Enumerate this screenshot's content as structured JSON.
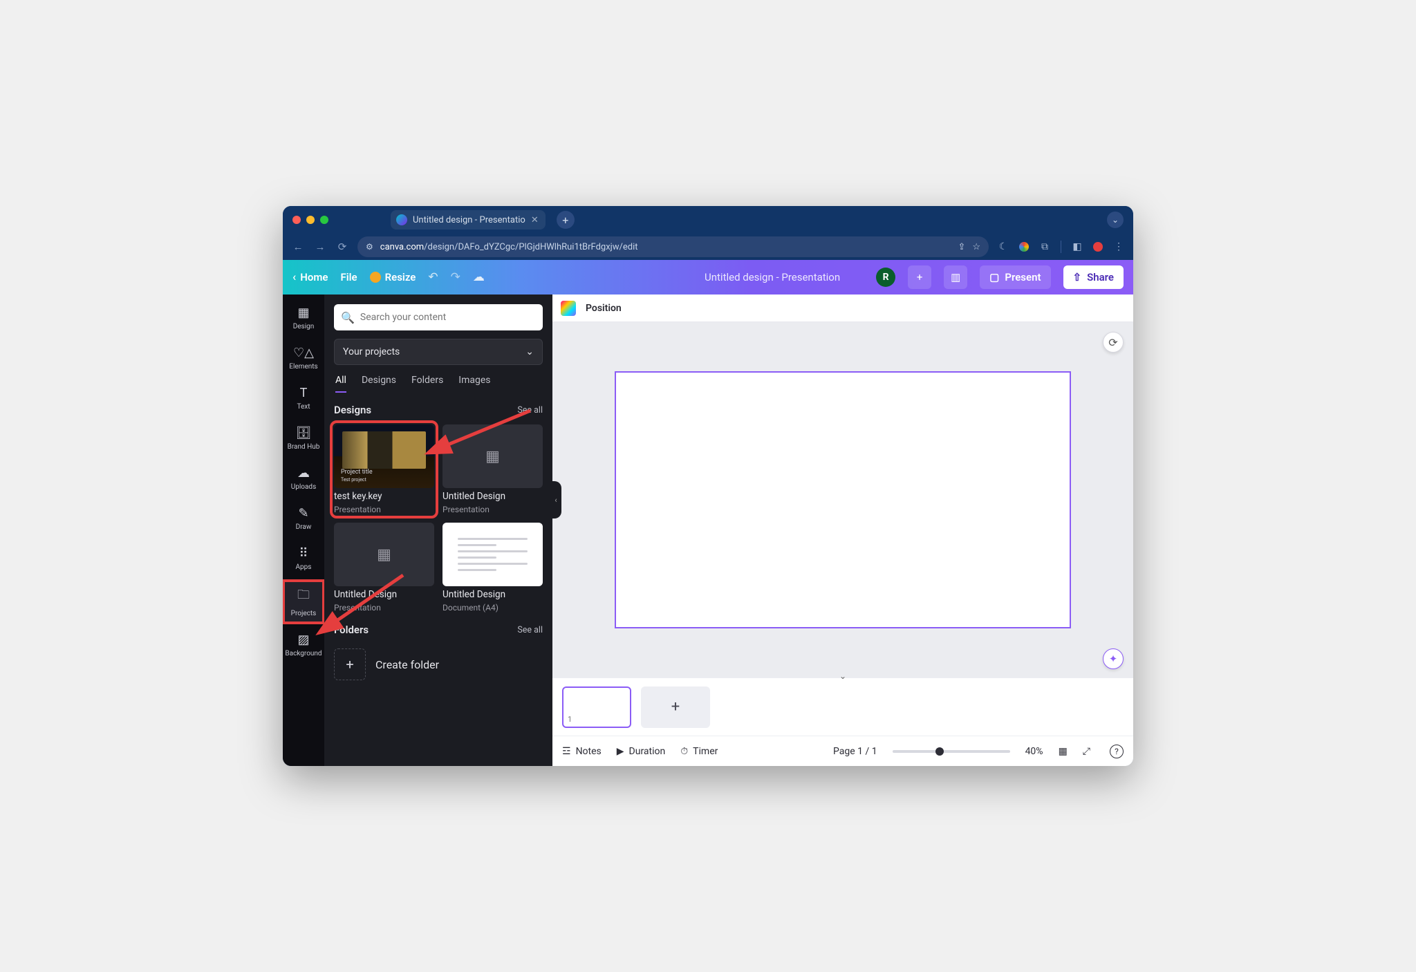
{
  "browser": {
    "tab_title": "Untitled design - Presentatio",
    "url_domain": "canva.com",
    "url_path": "/design/DAFo_dYZCgc/PlGjdHWlhRui1tBrFdgxjw/edit"
  },
  "toolbar": {
    "home": "Home",
    "file": "File",
    "resize": "Resize",
    "doc_title": "Untitled design - Presentation",
    "avatar_initial": "R",
    "present": "Present",
    "share": "Share"
  },
  "rail": {
    "items": [
      {
        "label": "Design"
      },
      {
        "label": "Elements"
      },
      {
        "label": "Text"
      },
      {
        "label": "Brand Hub"
      },
      {
        "label": "Uploads"
      },
      {
        "label": "Draw"
      },
      {
        "label": "Apps"
      },
      {
        "label": "Projects"
      },
      {
        "label": "Background"
      }
    ]
  },
  "panel": {
    "search_placeholder": "Search your content",
    "dropdown_value": "Your projects",
    "tabs": [
      "All",
      "Designs",
      "Folders",
      "Images"
    ],
    "designs_label": "Designs",
    "see_all": "See all",
    "designs": [
      {
        "title": "test key.key",
        "subtitle": "Presentation",
        "slide_title": "Project title",
        "slide_sub": "Test project"
      },
      {
        "title": "Untitled Design",
        "subtitle": "Presentation"
      },
      {
        "title": "Untitled Design",
        "subtitle": "Presentation"
      },
      {
        "title": "Untitled Design",
        "subtitle": "Document (A4)"
      }
    ],
    "folders_label": "Folders",
    "create_folder": "Create folder"
  },
  "stage": {
    "position_label": "Position"
  },
  "slides": {
    "page1_num": "1"
  },
  "footer": {
    "notes": "Notes",
    "duration": "Duration",
    "timer": "Timer",
    "page_indicator": "Page 1 / 1",
    "zoom": "40%"
  }
}
